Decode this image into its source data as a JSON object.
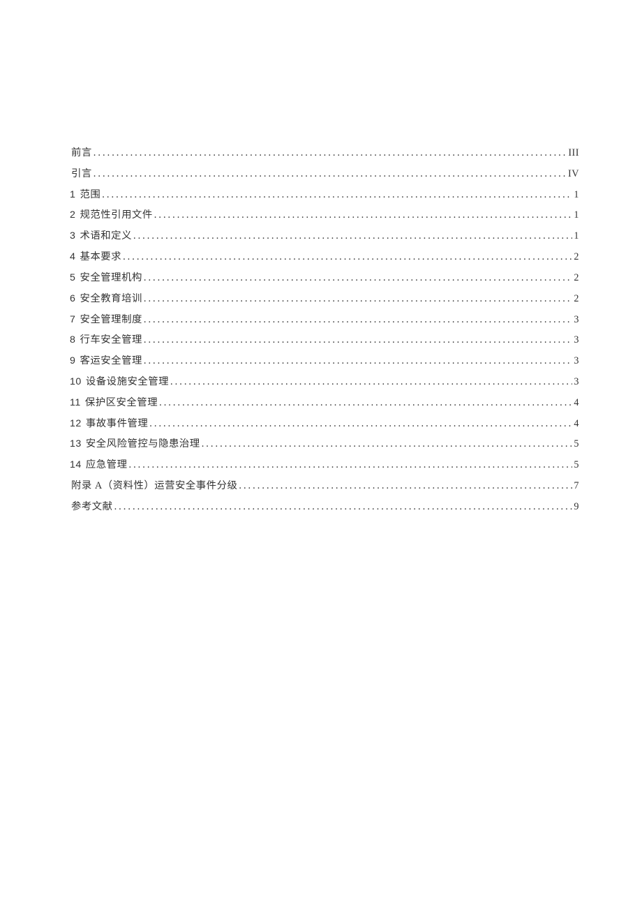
{
  "toc": {
    "entries": [
      {
        "prefix": "",
        "title": "前言",
        "page": "III"
      },
      {
        "prefix": "",
        "title": "引言",
        "page": "IV"
      },
      {
        "prefix": "1",
        "title": "范围",
        "page": "1"
      },
      {
        "prefix": "2",
        "title": "规范性引用文件",
        "page": "1"
      },
      {
        "prefix": "3",
        "title": "术语和定义",
        "page": "1"
      },
      {
        "prefix": "4",
        "title": "基本要求",
        "page": "2"
      },
      {
        "prefix": "5",
        "title": "安全管理机构",
        "page": "2"
      },
      {
        "prefix": "6",
        "title": "安全教育培训",
        "page": "2"
      },
      {
        "prefix": "7",
        "title": "安全管理制度",
        "page": "3"
      },
      {
        "prefix": "8",
        "title": "行车安全管理",
        "page": "3"
      },
      {
        "prefix": "9",
        "title": "客运安全管理",
        "page": "3"
      },
      {
        "prefix": "10",
        "title": "设备设施安全管理",
        "page": "3"
      },
      {
        "prefix": "11",
        "title": "保护区安全管理",
        "page": "4"
      },
      {
        "prefix": "12",
        "title": "事故事件管理",
        "page": "4"
      },
      {
        "prefix": "13",
        "title": "安全风险管控与隐患治理",
        "page": "5"
      },
      {
        "prefix": "14",
        "title": "应急管理",
        "page": "5"
      },
      {
        "prefix": "",
        "title": "附录 A（资料性）运营安全事件分级",
        "page": "7"
      },
      {
        "prefix": "",
        "title": "参考文献",
        "page": "9"
      }
    ]
  }
}
